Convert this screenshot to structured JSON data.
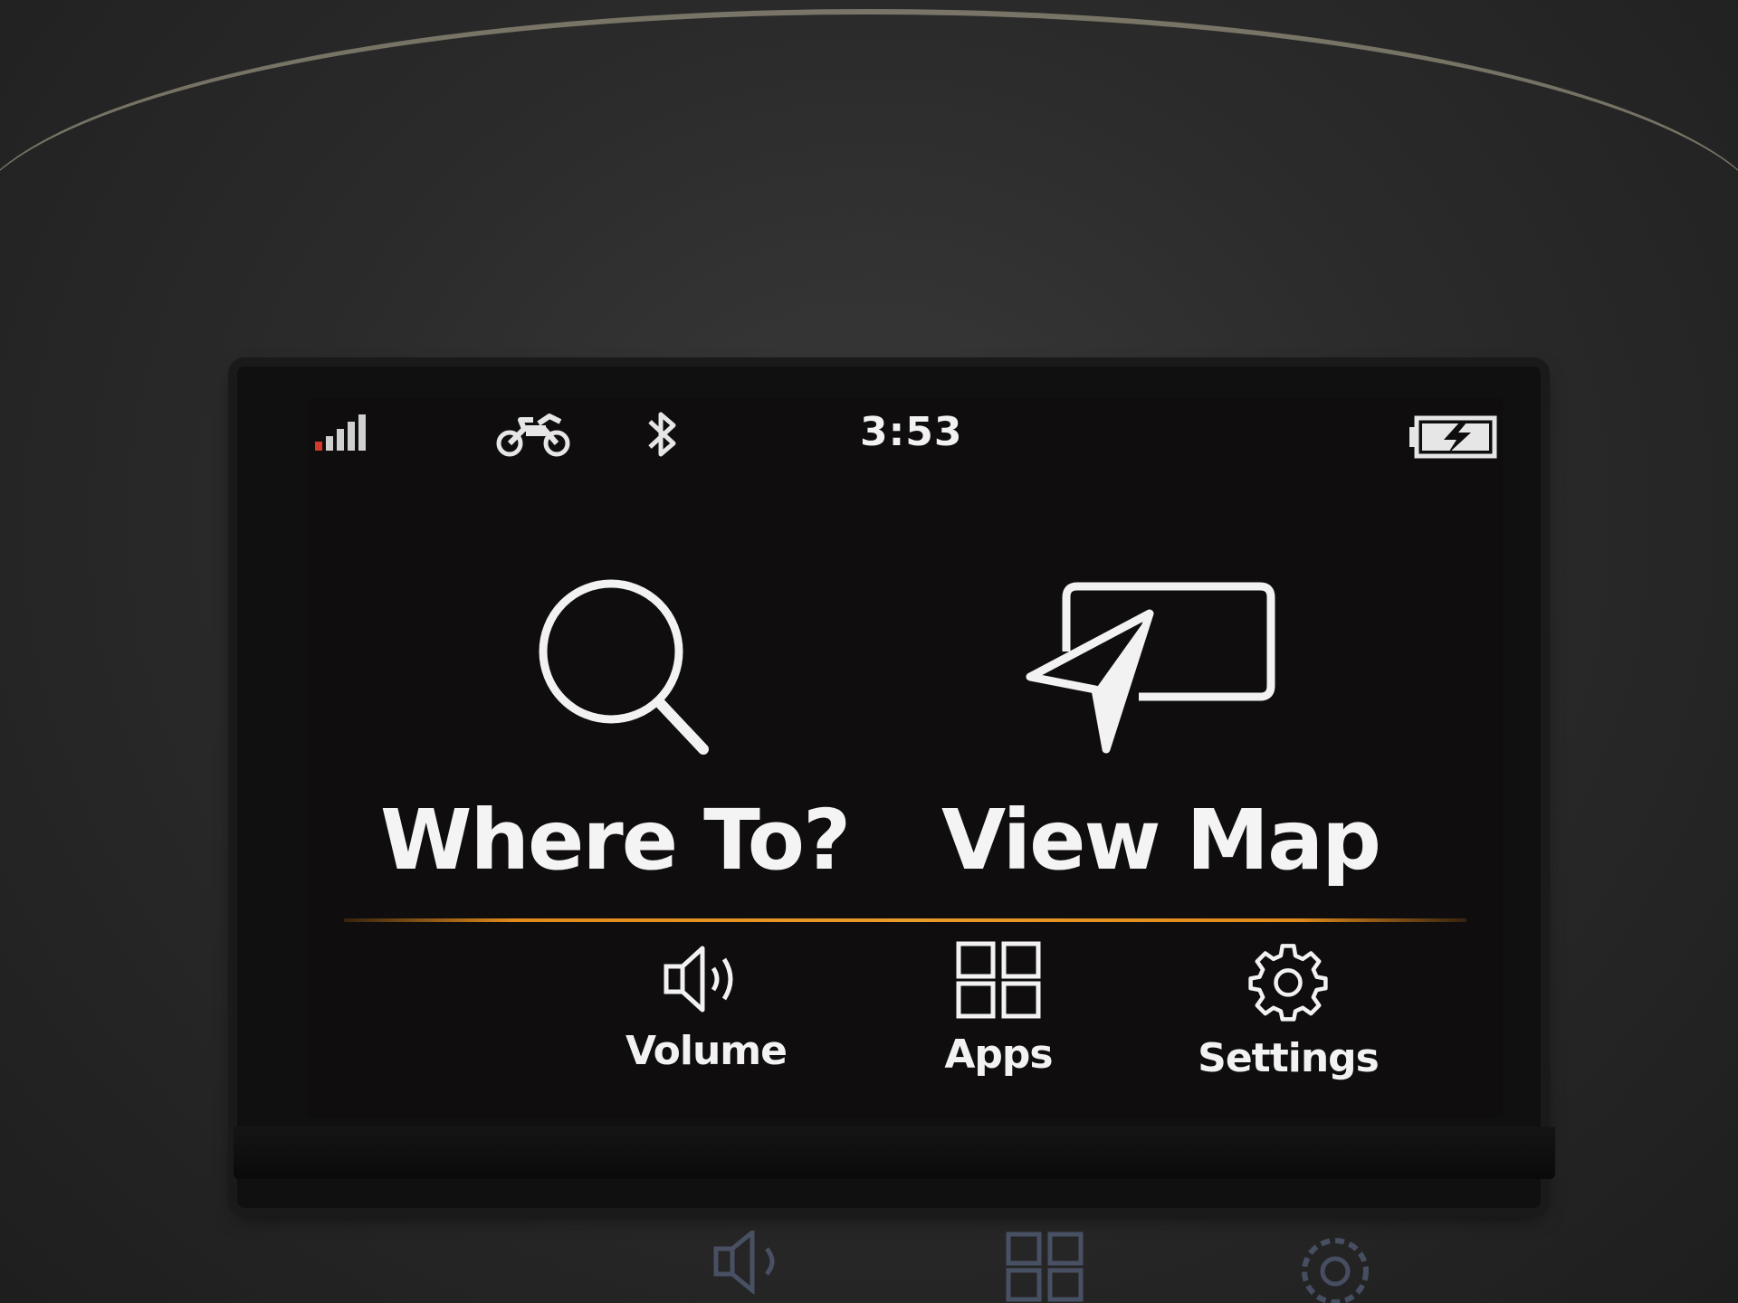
{
  "status_bar": {
    "clock": "3:53",
    "signal_icon": "signal-strength-icon",
    "profile_icon": "motorcycle-icon",
    "bluetooth_icon": "bluetooth-icon",
    "battery_icon": "battery-charging-icon"
  },
  "main": {
    "where_to": {
      "label": "Where To?",
      "icon": "search-icon"
    },
    "view_map": {
      "label": "View Map",
      "icon": "map-navigation-icon"
    }
  },
  "bottom_bar": {
    "volume": {
      "label": "Volume",
      "icon": "speaker-icon"
    },
    "apps": {
      "label": "Apps",
      "icon": "apps-grid-icon"
    },
    "settings": {
      "label": "Settings",
      "icon": "gear-icon"
    }
  },
  "colors": {
    "accent_divider": "#e08a1c",
    "signal_low": "#d23a2a",
    "screen_bg": "#0f0d0d",
    "text": "#f4f4f4"
  }
}
